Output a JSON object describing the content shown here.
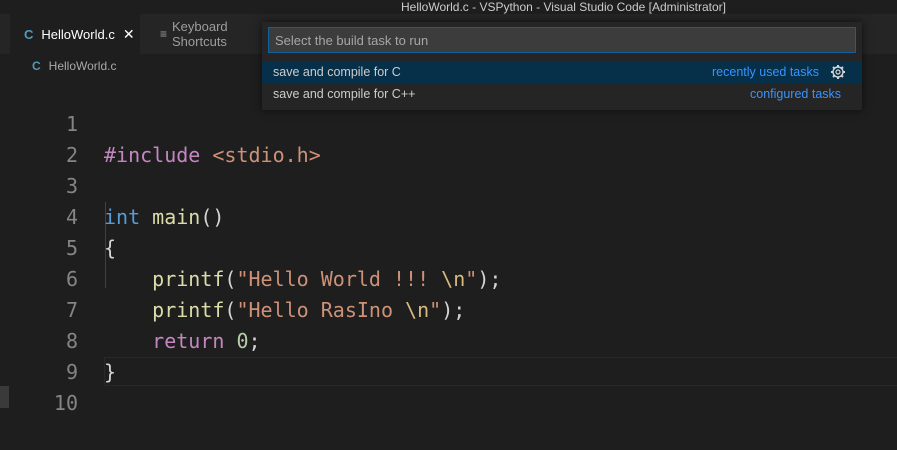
{
  "window": {
    "title": "HelloWorld.c - VSPython - Visual Studio Code [Administrator]"
  },
  "tabs": [
    {
      "icon": "C",
      "label": "HelloWorld.c",
      "close": "✕"
    },
    {
      "icon": "≡",
      "label": "Keyboard Shortcuts"
    }
  ],
  "breadcrumb": {
    "icon": "C",
    "file": "HelloWorld.c"
  },
  "editor": {
    "line_numbers": [
      "1",
      "2",
      "3",
      "4",
      "5",
      "6",
      "7",
      "8",
      "9",
      "10"
    ],
    "code": {
      "l1": {
        "pp": "#include",
        "inc": " <stdio.h>"
      },
      "l3": {
        "kw": "int",
        "fn": "main",
        "p": "()"
      },
      "l4": {
        "p": "{"
      },
      "l5": {
        "fn": "printf",
        "p1": "(",
        "s1": "\"Hello World !!! ",
        "esc": "\\n",
        "s2": "\"",
        "p2": ");"
      },
      "l6": {
        "fn": "printf",
        "p1": "(",
        "s1": "\"Hello RasIno ",
        "esc": "\\n",
        "s2": "\"",
        "p2": ");"
      },
      "l7": {
        "ctl": "return",
        "num": "0",
        "p": ";"
      },
      "l8": {
        "p": "}"
      }
    }
  },
  "quick_pick": {
    "placeholder": "Select the build task to run",
    "items": [
      {
        "label": "save and compile for C",
        "tag": "recently used tasks",
        "icon": "gear-icon"
      },
      {
        "label": "save and compile for C++",
        "tag": "configured tasks"
      }
    ]
  },
  "colors": {
    "accent": "#3794ff",
    "selection": "#062f4a",
    "input_border": "#0e639c"
  }
}
